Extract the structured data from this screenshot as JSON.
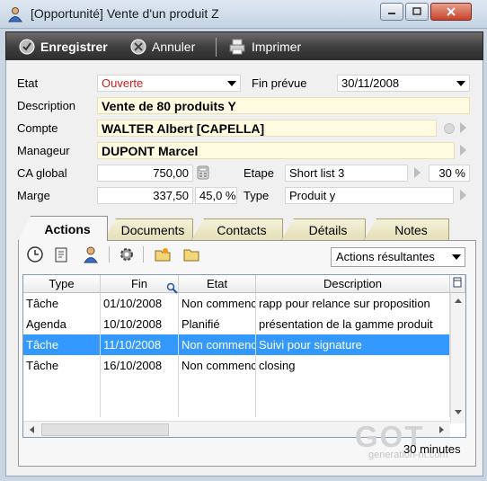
{
  "window": {
    "title": "[Opportunité] Vente d'un produit Z"
  },
  "toolbar": {
    "save_label": "Enregistrer",
    "cancel_label": "Annuler",
    "print_label": "Imprimer"
  },
  "form": {
    "etat_label": "Etat",
    "etat_value": "Ouverte",
    "fin_prevue_label": "Fin prévue",
    "fin_prevue_value": "30/11/2008",
    "description_label": "Description",
    "description_value": "Vente de 80 produits Y",
    "compte_label": "Compte",
    "compte_value": "WALTER Albert  [CAPELLA]",
    "manageur_label": "Manageur",
    "manageur_value": "DUPONT Marcel",
    "ca_label": "CA global",
    "ca_value": "750,00",
    "etape_label": "Etape",
    "etape_value": "Short list 3",
    "etape_pct": "30 %",
    "marge_label": "Marge",
    "marge_value": "337,50",
    "marge_pct": "45,0 %",
    "type_label": "Type",
    "type_value": "Produit y"
  },
  "tabs": [
    "Actions",
    "Documents",
    "Contacts",
    "Détails",
    "Notes"
  ],
  "actions_filter": "Actions résultantes",
  "grid": {
    "headers": [
      "Type",
      "Fin",
      "Etat",
      "Description"
    ],
    "rows": [
      {
        "type": "Tâche",
        "fin": "01/10/2008",
        "etat": "Non commencé",
        "desc": "rapp pour relance sur proposition"
      },
      {
        "type": "Agenda",
        "fin": "10/10/2008",
        "etat": "Planifié",
        "desc": "présentation de la gamme produit"
      },
      {
        "type": "Tâche",
        "fin": "11/10/2008",
        "etat": "Non commencé",
        "desc": "Suivi pour signature",
        "selected": true
      },
      {
        "type": "Tâche",
        "fin": "16/10/2008",
        "etat": "Non commencé",
        "desc": "closing"
      }
    ]
  },
  "duration": "30 minutes",
  "watermark": {
    "logo": "GOT",
    "site": "generation-nt.com"
  },
  "colors": {
    "accent_red": "#d41a1a",
    "selection": "#3399ff",
    "toolbar": "#3f3f3f"
  }
}
